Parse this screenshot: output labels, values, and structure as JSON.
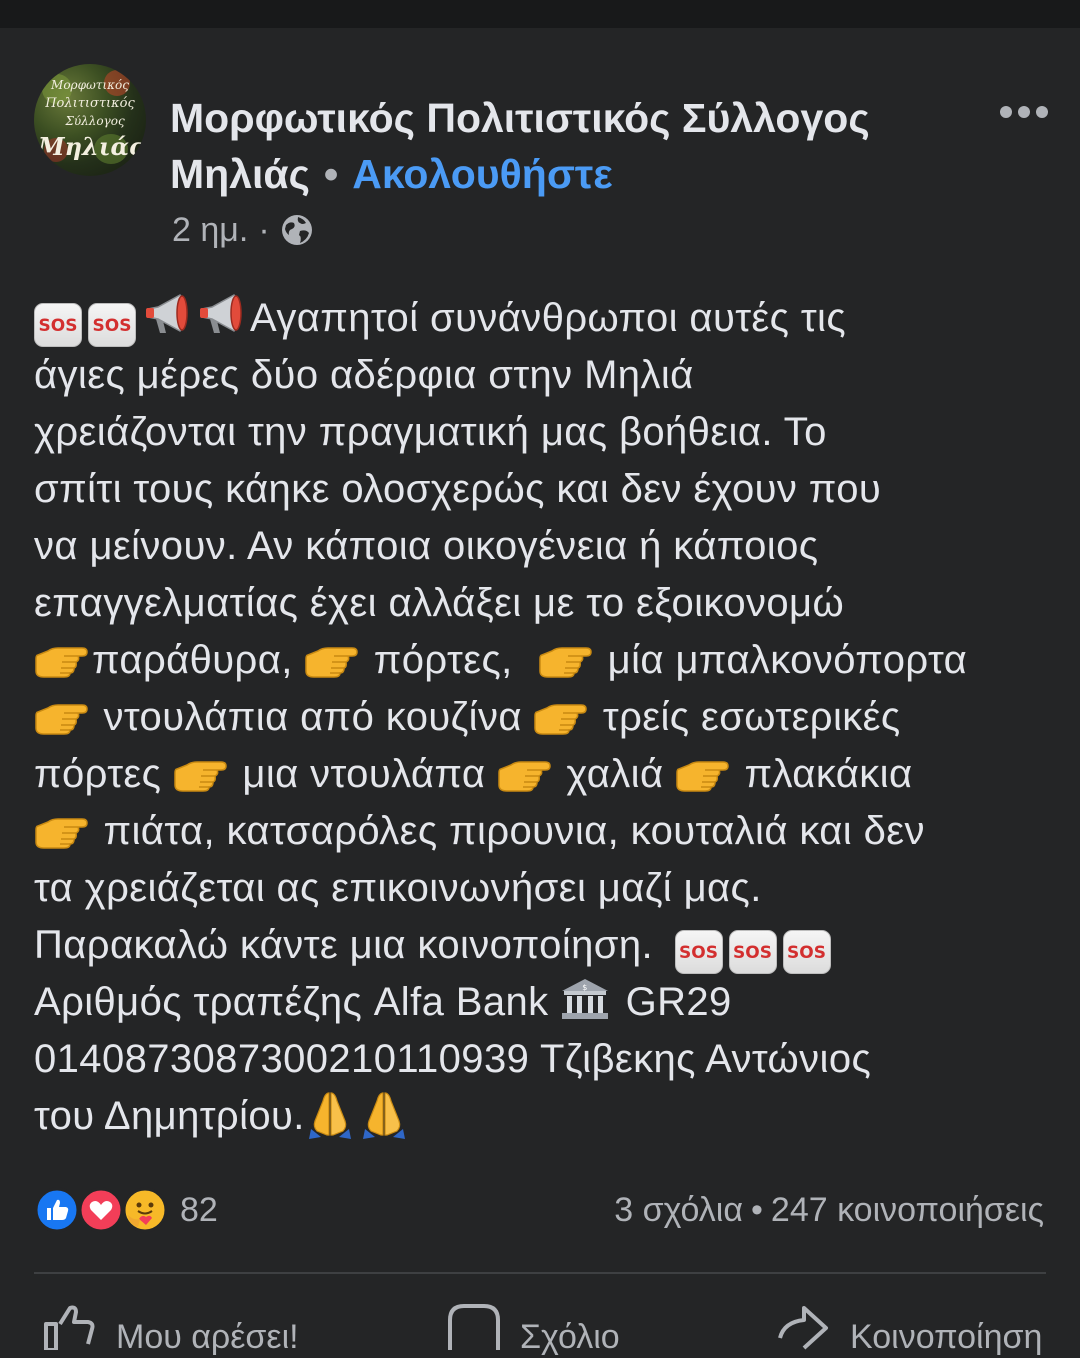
{
  "post": {
    "avatar": {
      "lines": [
        "Μορφωτικός",
        "Πολιτιστικός",
        "Σύλλογος",
        "Μηλιάς"
      ]
    },
    "page_name": "Μορφωτικός Πολιτιστικός Σύλλογος Μηλιάς",
    "follow_separator": "•",
    "follow_label": "Ακολουθήστε",
    "time": "2 ημ.",
    "time_separator": "·",
    "privacy_icon": "globe-icon",
    "more_icon": "more-horizontal-icon",
    "body_lines": [
      "Αγαπητοί συνάνθρωποι αυτές τις",
      "άγιες μέρες δύο αδέρφια στην Μηλιά",
      "χρειάζονται την πραγματική μας βοήθεια. Το",
      "σπίτι τους κάηκε ολοσχερώς και δεν έχουν που",
      "να μείνουν. Αν κάποια οικογένεια ή κάποιος",
      "επαγγελματίας έχει αλλάξει με το εξοικονομώ",
      "παράθυρα,",
      "πόρτες,",
      "μία μπαλκονόπορτα",
      "ντουλάπια από κουζίνα",
      "τρείς εσωτερικές",
      "πόρτες",
      "μια ντουλάπα",
      "χαλιά",
      "πλακάκια",
      "πιάτα, κατσαρόλες πιρουνια, κουταλιά και δεν",
      "τα χρειάζεται ας επικοινωνήσει μαζί μας.",
      "Παρακαλώ κάντε μια κοινοποίηση.",
      "Αριθμός τραπέζης Alfa Bank",
      "GR29",
      "0140873087300210110939 Τζιβεκης Αντώνιος",
      "του Δημητρίου."
    ],
    "emoji": {
      "sos": "SOS",
      "pointing_hand": "backhand-index-pointing-right",
      "megaphone": "megaphone",
      "bank": "bank",
      "pray": "folded-hands"
    }
  },
  "reactions": {
    "icons": [
      "like-icon",
      "love-icon",
      "care-icon"
    ],
    "count": "82"
  },
  "stats": {
    "comments": "3 σχόλια",
    "separator": "•",
    "shares": "247 κοινοποιήσεις"
  },
  "actions": {
    "like_label": "Μου αρέσει!",
    "comment_label": "Σχόλιο",
    "share_label": "Κοινοποίηση"
  },
  "colors": {
    "background": "#242526",
    "text_primary": "#e4e6eb",
    "text_secondary": "#b0b3b8",
    "link": "#4b9bf5",
    "like_blue": "#1877f2",
    "love_red": "#f33e58"
  }
}
